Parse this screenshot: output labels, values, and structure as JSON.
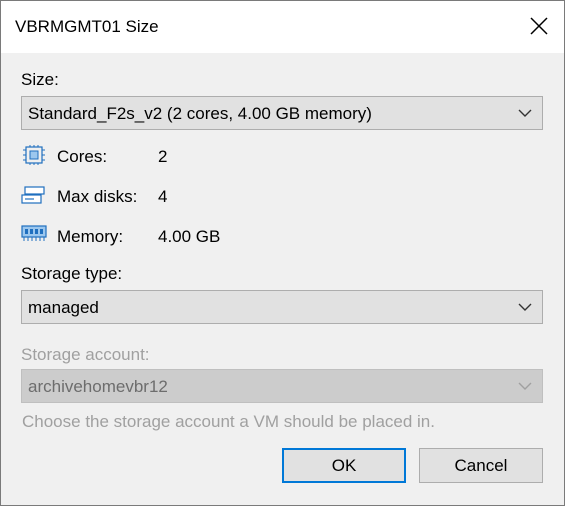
{
  "window": {
    "title": "VBRMGMT01 Size"
  },
  "size": {
    "label": "Size:",
    "selected": "Standard_F2s_v2 (2 cores, 4.00 GB memory)"
  },
  "specs": {
    "cores_label": "Cores:",
    "cores_value": "2",
    "disks_label": "Max disks:",
    "disks_value": "4",
    "memory_label": "Memory:",
    "memory_value": "4.00 GB"
  },
  "storage_type": {
    "label": "Storage type:",
    "selected": "managed"
  },
  "storage_account": {
    "label": "Storage account:",
    "selected": "archivehomevbr12",
    "hint": "Choose the storage account a VM should be placed in."
  },
  "buttons": {
    "ok": "OK",
    "cancel": "Cancel"
  },
  "icons": {
    "close": "close-icon",
    "cpu": "cpu-icon",
    "disk": "disk-icon",
    "memory": "memory-icon",
    "chevron": "chevron-down-icon"
  }
}
